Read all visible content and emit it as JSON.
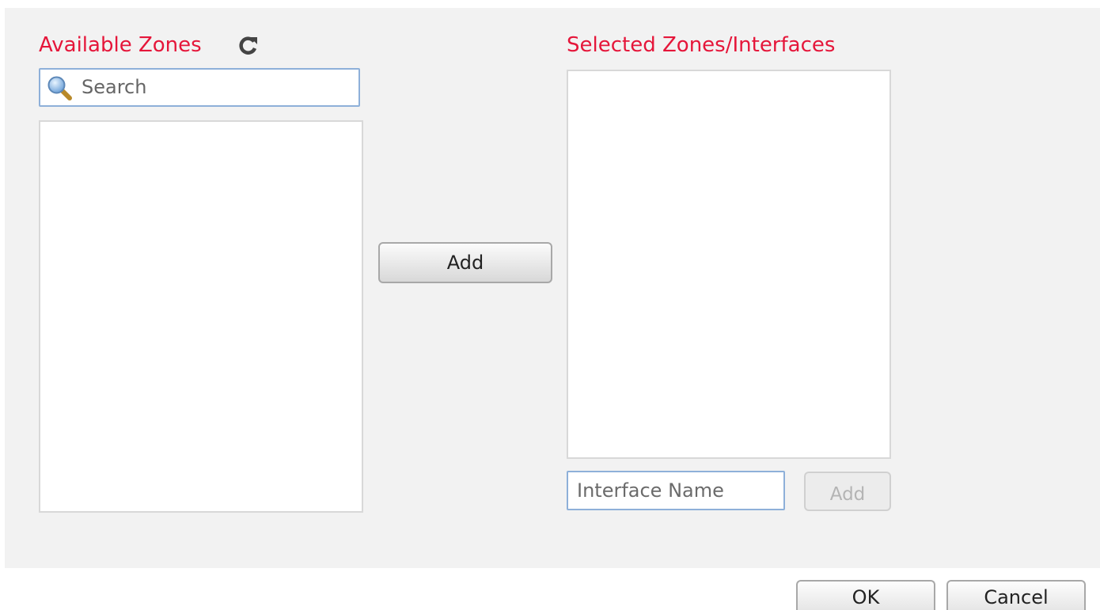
{
  "available": {
    "title": "Available Zones",
    "refresh_icon": "refresh-icon",
    "search_icon": "search-icon",
    "search_placeholder": "Search",
    "items": []
  },
  "add_button_label": "Add",
  "selected": {
    "title": "Selected Zones/Interfaces",
    "items": [],
    "interface_placeholder": "Interface Name",
    "add_button_label": "Add",
    "add_button_disabled": true
  },
  "footer": {
    "ok_label": "OK",
    "cancel_label": "Cancel"
  },
  "colors": {
    "title": "#e5163a",
    "panel_bg": "#f2f2f2",
    "input_border": "#8eb0d9"
  }
}
